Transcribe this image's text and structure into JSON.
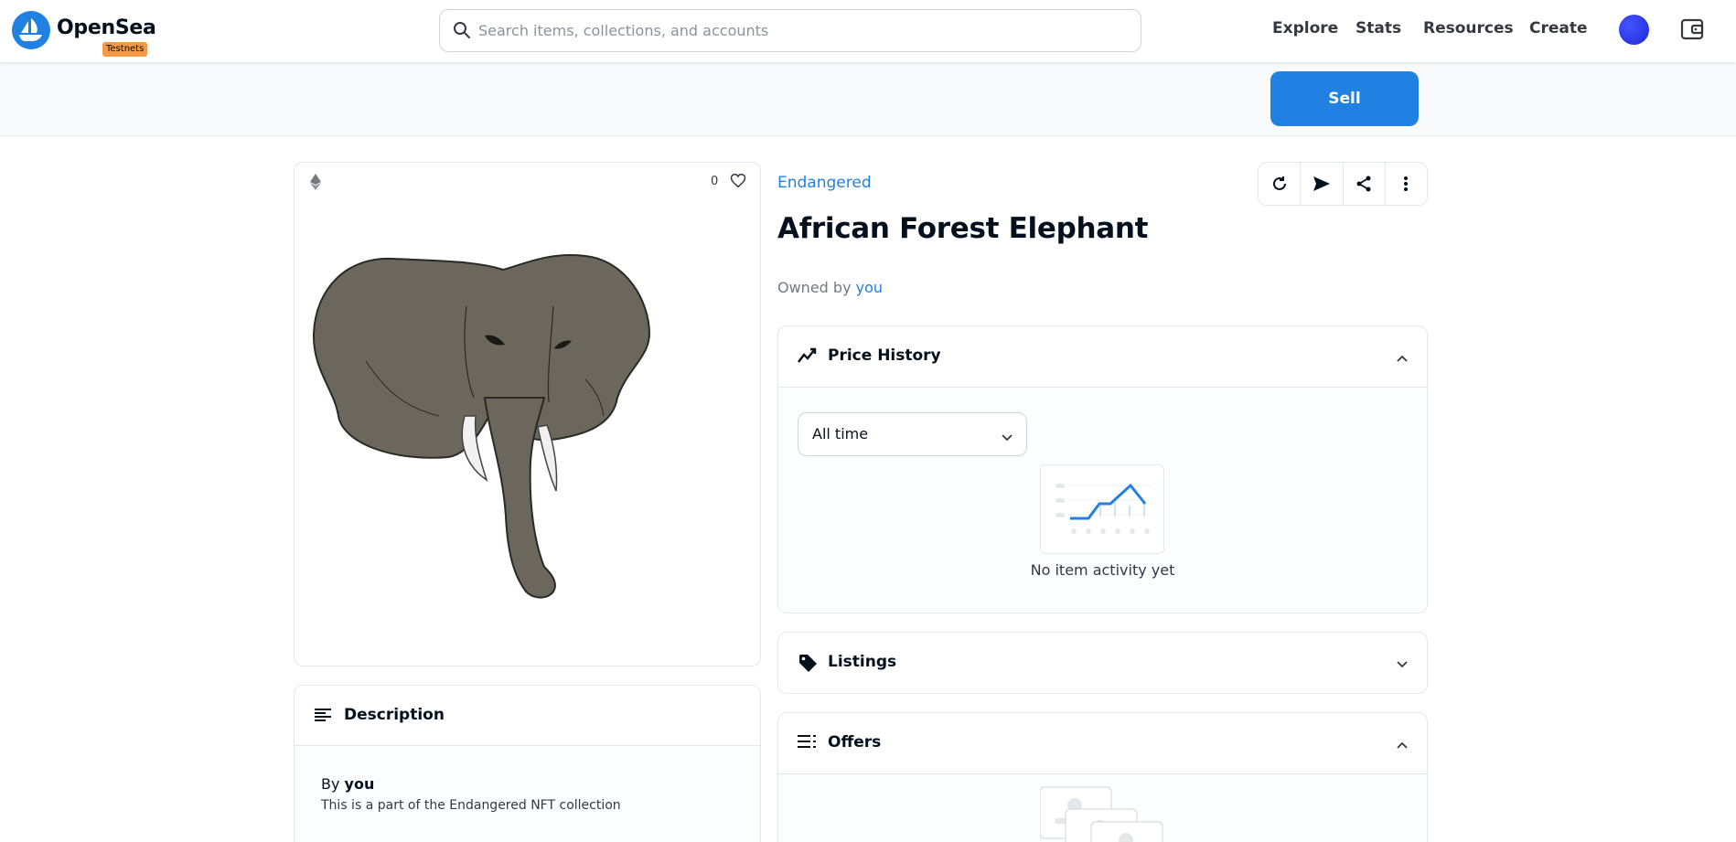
{
  "brand": {
    "name": "OpenSea",
    "badge": "Testnets"
  },
  "search": {
    "placeholder": "Search items, collections, and accounts"
  },
  "nav": {
    "explore": "Explore",
    "stats": "Stats",
    "resources": "Resources",
    "create": "Create"
  },
  "toolbar": {
    "sell_label": "Sell"
  },
  "item": {
    "collection": "Endangered",
    "title": "African Forest Elephant",
    "owned_by_prefix": "Owned by",
    "owner": "you",
    "likes": "0"
  },
  "description": {
    "title": "Description",
    "by_prefix": "By",
    "creator": "you",
    "text": "This is a part of the Endangered NFT collection"
  },
  "price_history": {
    "title": "Price History",
    "range_selected": "All time",
    "empty_text": "No item activity yet"
  },
  "listings": {
    "title": "Listings"
  },
  "offers": {
    "title": "Offers"
  },
  "colors": {
    "accent": "#2081e2",
    "badge": "#f2994a",
    "elephant": "#6b675c"
  },
  "icons": [
    "search-icon",
    "ethereum-icon",
    "heart-icon",
    "refresh-icon",
    "send-icon",
    "share-icon",
    "more-icon",
    "trend-icon",
    "tag-icon",
    "offers-list-icon",
    "chevron-up-icon",
    "chevron-down-icon",
    "wallet-icon"
  ]
}
